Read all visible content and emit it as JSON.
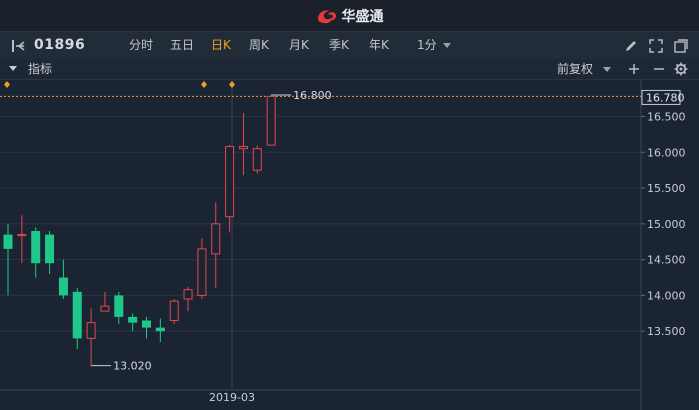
{
  "header": {
    "brand": "华盛通",
    "brand_icon": "huasheng-logo-icon"
  },
  "toolbar": {
    "code": "01896",
    "periods": [
      {
        "label": "分时",
        "active": false
      },
      {
        "label": "五日",
        "active": false
      },
      {
        "label": "日K",
        "active": true
      },
      {
        "label": "周K",
        "active": false
      },
      {
        "label": "月K",
        "active": false
      },
      {
        "label": "季K",
        "active": false
      },
      {
        "label": "年K",
        "active": false
      }
    ],
    "minute_label": "1分",
    "icons": [
      "panel-toggle-icon",
      "pen-icon",
      "fullscreen-icon",
      "window-icon"
    ]
  },
  "indicator_bar": {
    "label": "指标",
    "adjust_label": "前复权"
  },
  "colors": {
    "up": "#e0484e",
    "down": "#1fc88a",
    "accent": "#f0a020",
    "background": "#1b2433"
  },
  "chart_data": {
    "type": "candlestick",
    "ylim": [
      13.0,
      16.8
    ],
    "yticks": [
      16.5,
      16.0,
      15.5,
      15.0,
      14.5,
      14.0,
      13.5
    ],
    "ytick_labels": [
      "16.500",
      "16.000",
      "15.500",
      "15.000",
      "14.500",
      "14.000",
      "13.500"
    ],
    "last_price_label": "16.780",
    "last_price": 16.78,
    "high_label": "16.800",
    "high": 16.8,
    "low_label": "13.020",
    "low": 13.02,
    "xlabel_date": "2019-03",
    "candles": [
      {
        "o": 14.85,
        "c": 14.65,
        "h": 15.0,
        "l": 14.0
      },
      {
        "o": 14.85,
        "c": 14.85,
        "h": 15.12,
        "l": 14.45
      },
      {
        "o": 14.9,
        "c": 14.45,
        "h": 14.95,
        "l": 14.25
      },
      {
        "o": 14.85,
        "c": 14.45,
        "h": 14.9,
        "l": 14.3
      },
      {
        "o": 14.25,
        "c": 14.0,
        "h": 14.5,
        "l": 13.95
      },
      {
        "o": 14.05,
        "c": 13.4,
        "h": 14.1,
        "l": 13.25
      },
      {
        "o": 13.4,
        "c": 13.62,
        "h": 13.82,
        "l": 13.02
      },
      {
        "o": 13.78,
        "c": 13.85,
        "h": 14.05,
        "l": 13.78
      },
      {
        "o": 14.0,
        "c": 13.7,
        "h": 14.05,
        "l": 13.6
      },
      {
        "o": 13.7,
        "c": 13.62,
        "h": 13.75,
        "l": 13.5
      },
      {
        "o": 13.65,
        "c": 13.55,
        "h": 13.7,
        "l": 13.4
      },
      {
        "o": 13.55,
        "c": 13.5,
        "h": 13.68,
        "l": 13.35
      },
      {
        "o": 13.65,
        "c": 13.92,
        "h": 13.95,
        "l": 13.6
      },
      {
        "o": 13.95,
        "c": 14.08,
        "h": 14.12,
        "l": 13.78
      },
      {
        "o": 14.0,
        "c": 14.65,
        "h": 14.8,
        "l": 13.95
      },
      {
        "o": 14.58,
        "c": 15.0,
        "h": 15.3,
        "l": 14.1
      },
      {
        "o": 15.1,
        "c": 16.08,
        "h": 16.1,
        "l": 14.88
      },
      {
        "o": 16.05,
        "c": 16.08,
        "h": 16.55,
        "l": 15.68
      },
      {
        "o": 15.75,
        "c": 16.05,
        "h": 16.1,
        "l": 15.7
      },
      {
        "o": 16.1,
        "c": 16.78,
        "h": 16.8,
        "l": 16.1
      }
    ]
  }
}
